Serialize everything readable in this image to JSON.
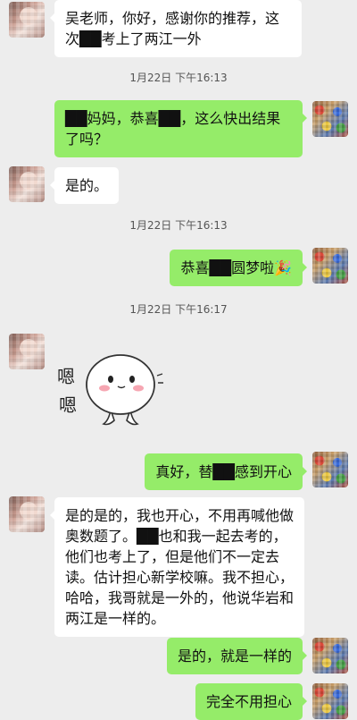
{
  "messages": [
    {
      "side": "left",
      "text": "吴老师，你好，感谢你的推荐，这次██考上了两江一外"
    },
    {
      "timestamp": "1月22日 下午16:13"
    },
    {
      "side": "right",
      "text": "██妈妈，恭喜██，这么快出结果了吗？"
    },
    {
      "side": "left",
      "text": "是的。"
    },
    {
      "timestamp": "1月22日 下午16:13"
    },
    {
      "side": "right",
      "text": "恭喜██圆梦啦🎉"
    },
    {
      "timestamp": "1月22日 下午16:17"
    },
    {
      "side": "left",
      "sticker": "嗯嗯"
    },
    {
      "side": "right",
      "text": "真好，替██感到开心"
    },
    {
      "side": "left",
      "text": "是的是的，我也开心，不用再喊他做奥数题了。██也和我一起去考的，他们也考上了，但是他们不一定去读。估计担心新学校嘛。我不担心，哈哈，我哥就是一外的，他说华岩和两江是一样的。"
    },
    {
      "side": "right",
      "text": "是的，就是一样的"
    },
    {
      "side": "right",
      "text": "完全不用担心"
    }
  ],
  "colors": {
    "background": "#ededed",
    "self_bubble": "#95ec69",
    "other_bubble": "#ffffff"
  }
}
